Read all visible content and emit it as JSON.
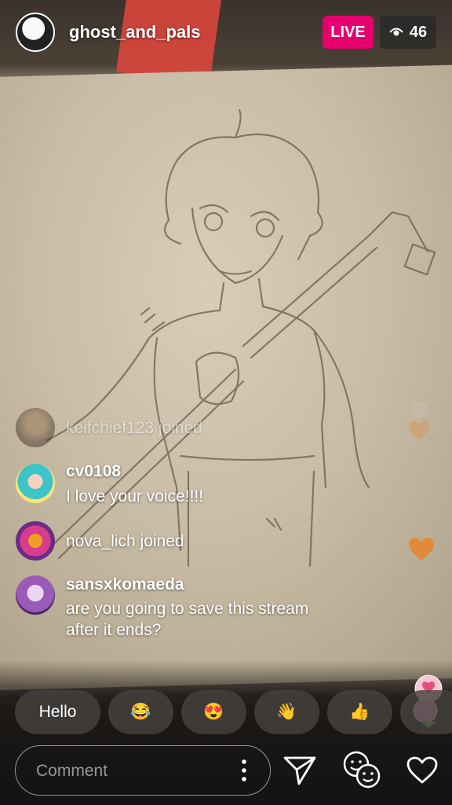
{
  "stream": {
    "username": "ghost_and_pals",
    "live_label": "LIVE",
    "viewer_count": "46"
  },
  "comments": [
    {
      "username": "keifchief123",
      "text": "joined",
      "display": "keifchief123 joined",
      "faded": true
    },
    {
      "username": "cv0108",
      "text": "I love your voice!!!!"
    },
    {
      "username": "nova_lich",
      "text": "joined",
      "display": "nova_lich joined"
    },
    {
      "username": "sansxkomaeda",
      "text_lines": [
        "are you going to save this stream",
        "after it ends?"
      ]
    }
  ],
  "quick_reactions": [
    {
      "label": "Hello"
    },
    {
      "label": "😂"
    },
    {
      "label": "😍"
    },
    {
      "label": "👋"
    },
    {
      "label": "👍"
    }
  ],
  "comment_bar": {
    "placeholder": "Comment"
  },
  "icons": {
    "more": "more-vertical-icon",
    "send": "send-icon",
    "face_filter": "face-filter-icon",
    "like": "heart-icon"
  },
  "colors": {
    "live_badge": "#e6006e",
    "heart_reaction": "#e08a3c"
  }
}
